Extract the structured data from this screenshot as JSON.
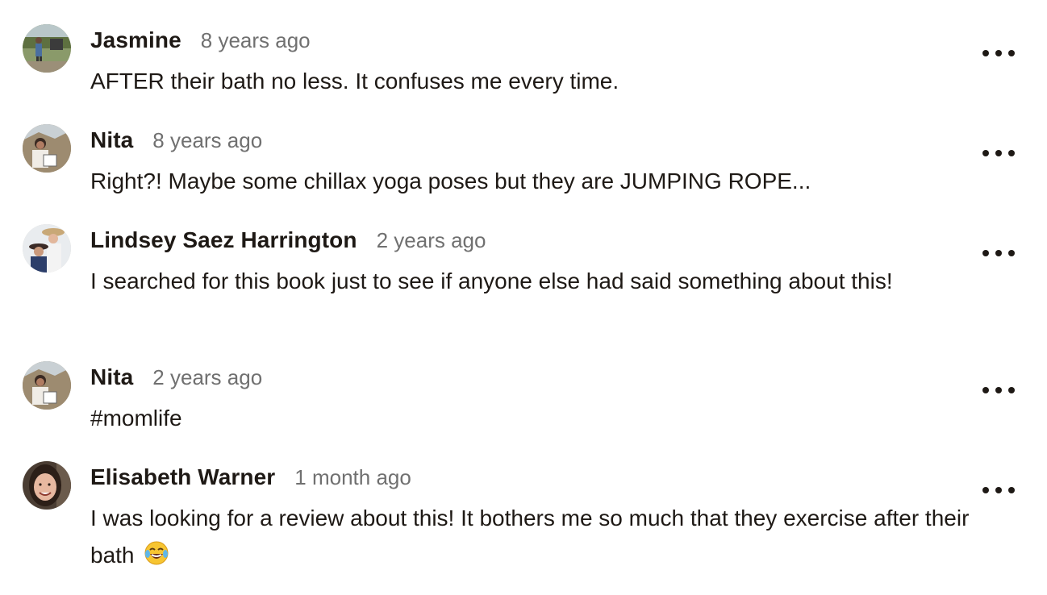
{
  "comments": [
    {
      "author": "Jasmine",
      "time": "8 years ago",
      "text": "AFTER their bath no less. It confuses me every time.",
      "avatar": "avatar-photo-outdoor-figure"
    },
    {
      "author": "Nita",
      "time": "8 years ago",
      "text": "Right?! Maybe some chillax yoga poses but they are JUMPING ROPE...",
      "avatar": "avatar-photo-woman-rocks"
    },
    {
      "author": "Lindsey Saez Harrington",
      "time": "2 years ago",
      "text": "I searched for this book just to see if anyone else had said something about this!",
      "avatar": "avatar-photo-couple-hats"
    },
    {
      "author": "Nita",
      "time": "2 years ago",
      "text": "#momlife",
      "avatar": "avatar-photo-woman-rocks"
    },
    {
      "author": "Elisabeth Warner",
      "time": "1 month ago",
      "text": "I was looking for a review about this! It bothers me so much that they exercise after their bath",
      "emoji": "😂",
      "avatar": "avatar-photo-woman-smiling"
    }
  ],
  "icons": {
    "more": "more-options-icon"
  },
  "colors": {
    "text": "#1e1915",
    "meta": "#707070",
    "background": "#ffffff"
  }
}
